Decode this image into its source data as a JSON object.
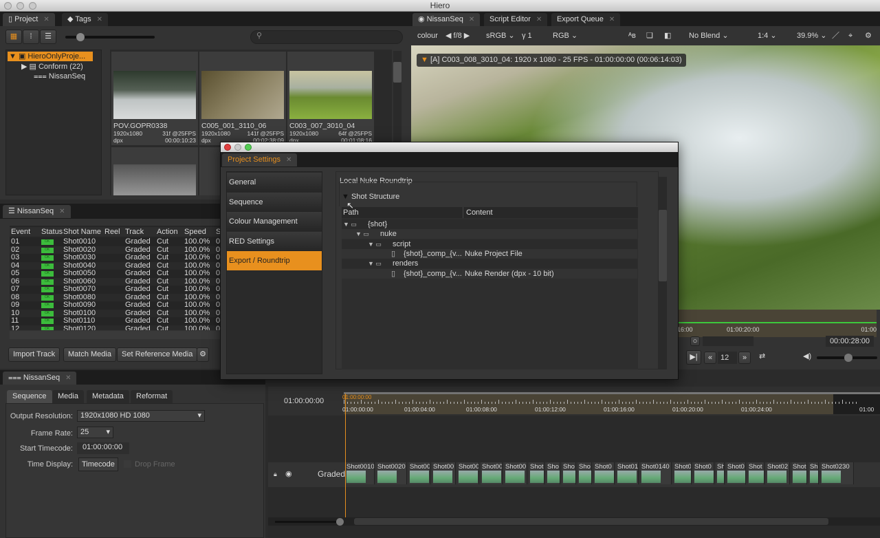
{
  "app_title": "Hiero",
  "project_panel": {
    "tabs": [
      {
        "label": "Project"
      },
      {
        "label": "Tags"
      }
    ],
    "tree": [
      {
        "label": "HieroOnlyProje..."
      },
      {
        "label": "Conform (22)"
      },
      {
        "label": "NissanSeq"
      }
    ],
    "clips": [
      {
        "name": "POV.GOPR0338",
        "res": "1920x1080",
        "frames": "31f @25FPS",
        "format": "dpx",
        "duration": "00:00:10:23"
      },
      {
        "name": "C005_001_3110_06",
        "res": "1920x1080",
        "frames": "141f @25FPS",
        "format": "dpx",
        "duration": "00:02:38:09"
      },
      {
        "name": "C003_007_3010_04",
        "res": "1920x1080",
        "frames": "64f @25FPS",
        "format": "dpx",
        "duration": "00:01:08:16"
      }
    ]
  },
  "spreadsheet": {
    "tab": "NissanSeq",
    "columns": [
      "Event",
      "Status",
      "Shot Name",
      "Reel",
      "Track",
      "Action",
      "Speed",
      "S"
    ],
    "rows": [
      [
        "01",
        "OK",
        "Shot0010",
        "",
        "Graded",
        "Cut",
        "100.0%",
        "0"
      ],
      [
        "02",
        "OK",
        "Shot0020",
        "",
        "Graded",
        "Cut",
        "100.0%",
        "0"
      ],
      [
        "03",
        "OK",
        "Shot0030",
        "",
        "Graded",
        "Cut",
        "100.0%",
        "0"
      ],
      [
        "04",
        "OK",
        "Shot0040",
        "",
        "Graded",
        "Cut",
        "100.0%",
        "0"
      ],
      [
        "05",
        "OK",
        "Shot0050",
        "",
        "Graded",
        "Cut",
        "100.0%",
        "0"
      ],
      [
        "06",
        "OK",
        "Shot0060",
        "",
        "Graded",
        "Cut",
        "100.0%",
        "0"
      ],
      [
        "07",
        "OK",
        "Shot0070",
        "",
        "Graded",
        "Cut",
        "100.0%",
        "0"
      ],
      [
        "08",
        "OK",
        "Shot0080",
        "",
        "Graded",
        "Cut",
        "100.0%",
        "0"
      ],
      [
        "09",
        "OK",
        "Shot0090",
        "",
        "Graded",
        "Cut",
        "100.0%",
        "0"
      ],
      [
        "10",
        "OK",
        "Shot0100",
        "",
        "Graded",
        "Cut",
        "100.0%",
        "0"
      ],
      [
        "11",
        "OK",
        "Shot0110",
        "",
        "Graded",
        "Cut",
        "100.0%",
        "0"
      ],
      [
        "12",
        "OK",
        "Shot0120",
        "",
        "Graded",
        "Cut",
        "100.0%",
        "0"
      ]
    ],
    "buttons": {
      "import": "Import Track",
      "match": "Match Media",
      "reference": "Set Reference Media"
    }
  },
  "viewer": {
    "tabs": [
      {
        "label": "NissanSeq"
      },
      {
        "label": "Script Editor"
      },
      {
        "label": "Export Queue"
      }
    ],
    "toolbar": {
      "channel": "colour",
      "fstop": "f/8",
      "colorspace": "sRGB",
      "gamma": "γ 1",
      "display": "RGB",
      "blend": "No Blend",
      "downscale": "1:4",
      "zoom": "39.9%"
    },
    "info": "[A] C003_008_3010_04: 1920 x 1080 - 25 FPS - 01:00:00:00 (00:06:14:03)",
    "ruler": [
      "16:00",
      "01:00:20:00",
      "01:00"
    ],
    "timecode": "00:00:28:00",
    "frame_step": "12"
  },
  "dialog": {
    "tab": "Project Settings",
    "nav": [
      {
        "label": "General"
      },
      {
        "label": "Sequence"
      },
      {
        "label": "Colour Management"
      },
      {
        "label": "RED Settings"
      },
      {
        "label": "Export / Roundtrip"
      }
    ],
    "group": "Local Nuke Roundtrip",
    "section": "Shot Structure",
    "columns": [
      "Path",
      "Content"
    ],
    "tree": [
      {
        "path": "{shot}",
        "content": ""
      },
      {
        "path": "nuke",
        "content": ""
      },
      {
        "path": "script",
        "content": ""
      },
      {
        "path": "{shot}_comp_{v...",
        "content": "Nuke Project File"
      },
      {
        "path": "renders",
        "content": ""
      },
      {
        "path": "{shot}_comp_{v...",
        "content": "Nuke Render (dpx - 10 bit)"
      }
    ]
  },
  "sequence_panel": {
    "tab": "NissanSeq",
    "subtabs": [
      {
        "label": "Sequence"
      },
      {
        "label": "Media"
      },
      {
        "label": "Metadata"
      },
      {
        "label": "Reformat"
      }
    ],
    "output_resolution_label": "Output Resolution:",
    "output_resolution": "1920x1080 HD 1080",
    "frame_rate_label": "Frame Rate:",
    "frame_rate": "25",
    "start_tc_label": "Start Timecode:",
    "start_tc": "01:00:00:00",
    "time_display_label": "Time Display:",
    "time_display": "Timecode",
    "drop_frame": "Drop Frame"
  },
  "timeline": {
    "current": "01:00:00:00",
    "playhead": "01:00:00:00",
    "ticks": [
      "01:00:00:00",
      "01:00:04:00",
      "01:00:08:00",
      "01:00:12:00",
      "01:00:16:00",
      "01:00:20:00",
      "01:00:24:00",
      "01:00"
    ],
    "track": "Graded",
    "clips": [
      "Shot0010",
      "Shot0020",
      "Shot00",
      "Shot00",
      "Shot00",
      "Shot00",
      "Shot00",
      "Shot",
      "Sho",
      "Sho",
      "Sho",
      "Shot0",
      "Shot01",
      "Shot0140",
      "Shot0",
      "Shot0",
      "Sh",
      "Shot0",
      "Shot",
      "Shot02",
      "Shot0",
      "Sh",
      "Shot0230"
    ]
  }
}
